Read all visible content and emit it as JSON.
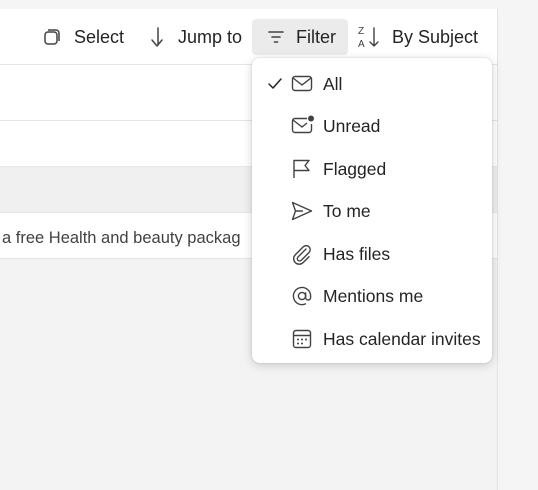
{
  "toolbar": {
    "select_label": "Select",
    "jump_label": "Jump to",
    "filter_label": "Filter",
    "sort_label": "By Subject"
  },
  "message_preview": "a free Health and beauty packag",
  "filter_menu": {
    "items": [
      {
        "label": "All",
        "icon": "mail-icon",
        "selected": true
      },
      {
        "label": "Unread",
        "icon": "mail-unread-icon",
        "selected": false
      },
      {
        "label": "Flagged",
        "icon": "flag-icon",
        "selected": false
      },
      {
        "label": "To me",
        "icon": "send-icon",
        "selected": false
      },
      {
        "label": "Has files",
        "icon": "attach-icon",
        "selected": false
      },
      {
        "label": "Mentions me",
        "icon": "mention-icon",
        "selected": false
      },
      {
        "label": "Has calendar invites",
        "icon": "calendar-icon",
        "selected": false
      }
    ]
  }
}
